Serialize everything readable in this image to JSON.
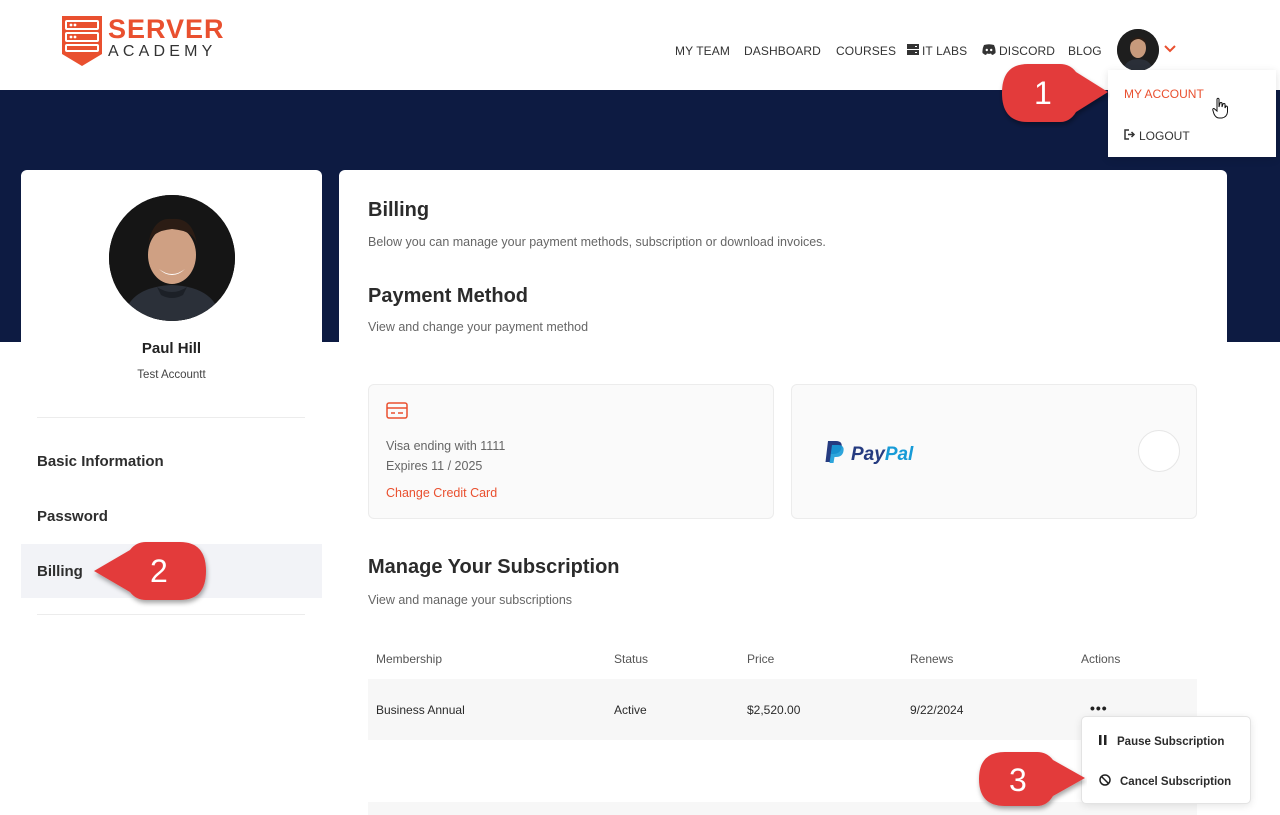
{
  "header": {
    "logo": {
      "line1": "SERVER",
      "line2": "ACADEMY"
    },
    "nav": [
      {
        "label": "MY TEAM"
      },
      {
        "label": "DASHBOARD"
      },
      {
        "label": "COURSES"
      },
      {
        "label": "IT LABS",
        "icon": "server-icon"
      },
      {
        "label": "DISCORD",
        "icon": "discord-icon"
      },
      {
        "label": "BLOG"
      }
    ]
  },
  "account_menu": {
    "my_account": "MY ACCOUNT",
    "logout": "LOGOUT"
  },
  "profile": {
    "name": "Paul Hill",
    "subtitle": "Test Accountt"
  },
  "sidebar": {
    "items": [
      {
        "label": "Basic Information"
      },
      {
        "label": "Password"
      },
      {
        "label": "Billing",
        "active": true
      }
    ]
  },
  "billing": {
    "title": "Billing",
    "description": "Below you can manage your payment methods, subscription or download invoices.",
    "payment_method": {
      "title": "Payment Method",
      "description": "View and change your payment method",
      "card_line1": "Visa ending with 1111",
      "card_line2": "Expires 11 / 2025",
      "change_link": "Change Credit Card",
      "paypal_label": "PayPal"
    },
    "subscription": {
      "title": "Manage Your Subscription",
      "description": "View and manage your subscriptions",
      "columns": [
        "Membership",
        "Status",
        "Price",
        "Renews",
        "Actions"
      ],
      "rows": [
        {
          "membership": "Business Annual",
          "status": "Active",
          "price": "$2,520.00",
          "renews": "9/22/2024",
          "actions": "•••"
        }
      ]
    }
  },
  "actions_menu": {
    "pause": "Pause Subscription",
    "cancel": "Cancel Subscription"
  },
  "callouts": {
    "one": "1",
    "two": "2",
    "three": "3"
  },
  "colors": {
    "accent": "#e9502f",
    "navy": "#0d1b42",
    "callout_red": "#e33a3a",
    "paypal_dark": "#253b80",
    "paypal_light": "#179bd7"
  }
}
